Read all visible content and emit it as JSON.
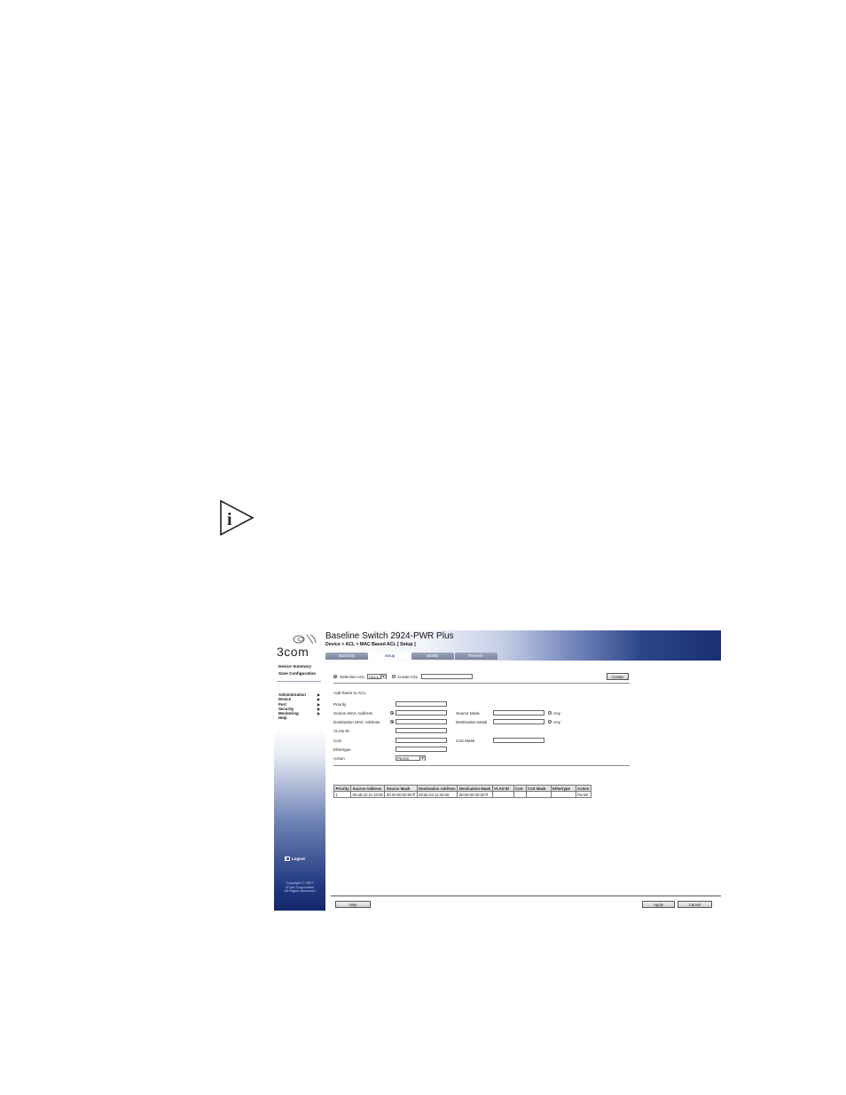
{
  "window": {
    "app_title": "Baseline Switch 2924-PWR Plus",
    "breadcrumb": "Device > ACL > MAC Based ACL [ Setup ]",
    "logo_text": "3com"
  },
  "sidebar": {
    "top_links": [
      "Device Summary",
      "Save Configuration"
    ],
    "menu": [
      "Administration",
      "Device",
      "Port",
      "Security",
      "Monitoring",
      "Help"
    ],
    "logout": "Logout",
    "copyright": [
      "Copyright © 2007",
      "3Com Corporation",
      "All Rights Reserved"
    ]
  },
  "tabs": [
    {
      "label": "Summary",
      "active": false
    },
    {
      "label": "Setup",
      "active": true
    },
    {
      "label": "Modify",
      "active": false
    },
    {
      "label": "Remove",
      "active": false
    }
  ],
  "acl": {
    "selection_label": "Selection ACL",
    "selection_value": "ACL1",
    "create_label": "Create ACL",
    "create_value": "",
    "create_button": "Create"
  },
  "rules_form": {
    "section_title": "Add Rules to ACL:",
    "priority_label": "Priority",
    "src_mac_label": "Source MAC Address",
    "dst_mac_label": "Destination MAC Address",
    "vlan_label": "VLAN ID",
    "cos_label": "CoS",
    "ethertype_label": "Ethertype",
    "action_label": "Action",
    "action_value": "Permit",
    "src_mask_label": "Source Mask",
    "dst_mask_label": "Destination Mask",
    "cos_mask_label": "CoS Mask",
    "any_label": "Any"
  },
  "rules_table": {
    "headers": [
      "Priority",
      "Source Address",
      "Source Mask",
      "Destination Address",
      "Destination Mask",
      "VLAN ID",
      "CoS",
      "CoS Mask",
      "Ethertype",
      "Action"
    ],
    "rows": [
      [
        "1",
        "00:ab:22:11:33:00",
        "00:00:00:00:00:ff",
        "00:ab:22:11:34:00",
        "00:00:00:00:00:ff",
        "",
        "",
        "",
        "",
        "Permit"
      ]
    ]
  },
  "footer": {
    "help_button": "Help",
    "apply_button": "Apply",
    "cancel_button": "Cancel"
  },
  "colors": {
    "header_dark": "#1a2f73",
    "sidebar_dark": "#14286b",
    "active_tab_text": "#1b2f8a"
  }
}
